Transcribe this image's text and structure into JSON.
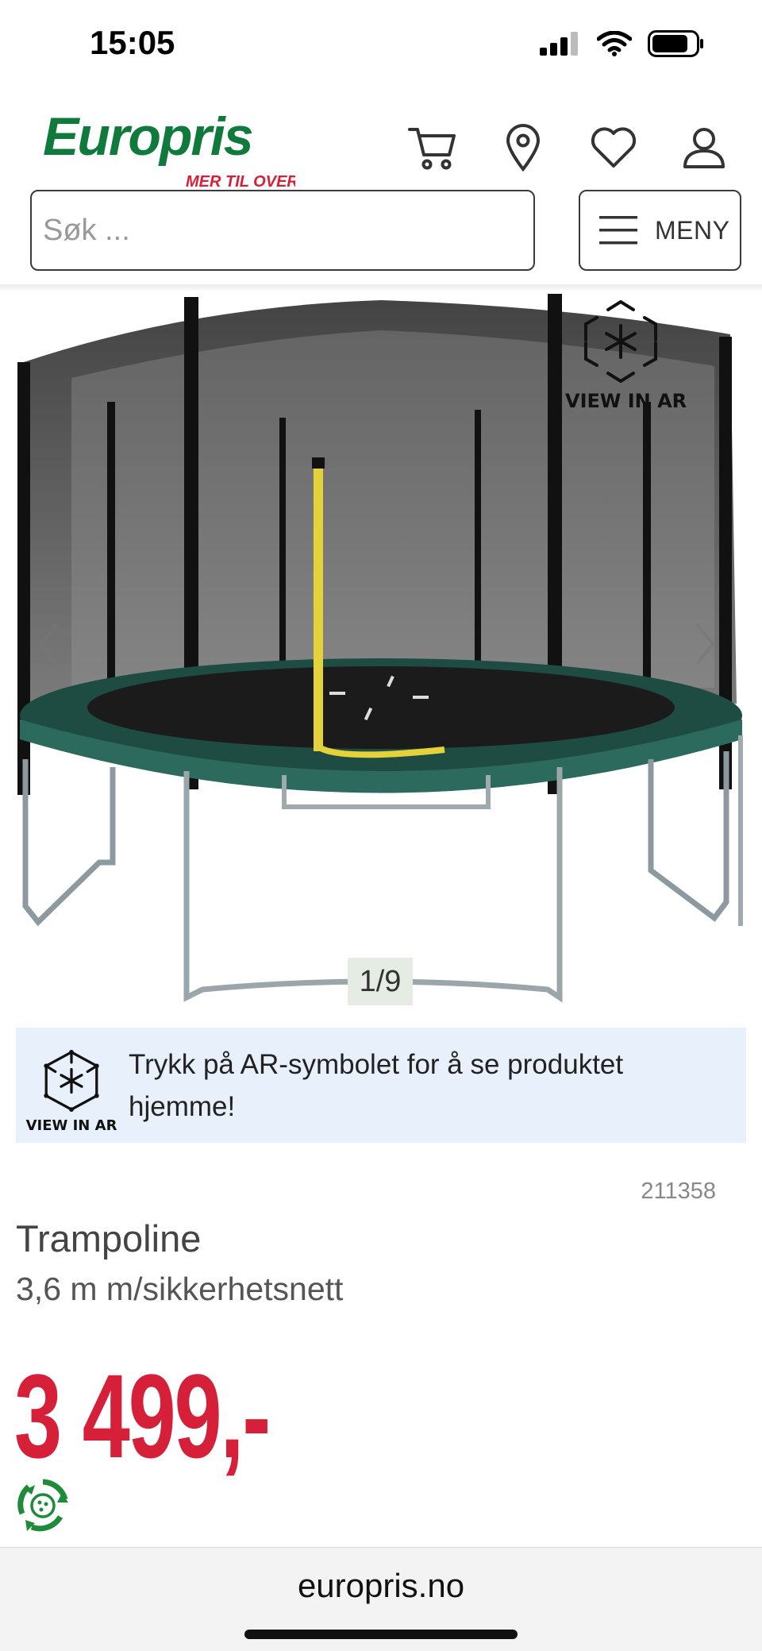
{
  "status_bar": {
    "time": "15:05"
  },
  "header": {
    "logo_name": "Europris",
    "logo_tagline": "MER TIL OVERS",
    "brand_green": "#0f7a3c",
    "brand_red": "#d6203a",
    "icons": [
      "cart-icon",
      "location-pin-icon",
      "heart-icon",
      "user-icon"
    ]
  },
  "search": {
    "placeholder": "Søk ..."
  },
  "menu": {
    "label": "MENY"
  },
  "gallery": {
    "ar_label": "VIEW IN AR",
    "counter": "1/9"
  },
  "ar_info": {
    "ar_label": "VIEW IN AR",
    "text": "Trykk på AR-symbolet for å se produktet hjemme!"
  },
  "product": {
    "sku": "211358",
    "title": "Trampoline",
    "subtitle": "3,6 m m/sikkerhetsnett",
    "price": "3 499,-",
    "price_color": "#d6203a"
  },
  "browser": {
    "url": "europris.no"
  }
}
